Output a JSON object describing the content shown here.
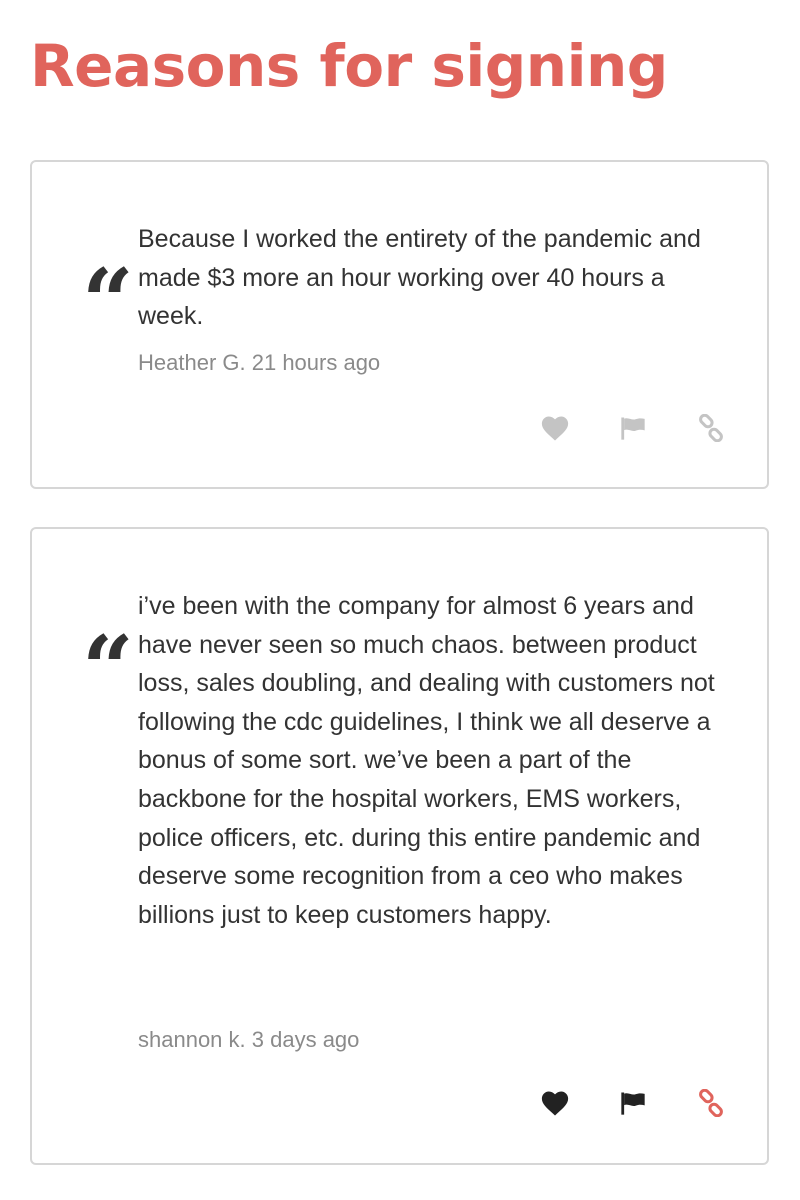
{
  "page": {
    "title": "Reasons for signing"
  },
  "colors": {
    "accent": "#e0645c",
    "text": "#333333",
    "muted": "#8a8a8a",
    "icon_inactive": "#c4c4c4",
    "icon_active": "#222222",
    "border": "#d6d6d6"
  },
  "reasons": [
    {
      "quote_glyph": "“",
      "text": "Because I worked the entirety of the pandemic and made $3 more an hour working over 40 hours a week.",
      "author": "Heather G.",
      "time_ago": "21 hours ago",
      "actions": [
        {
          "icon": "heart-icon",
          "state": "inactive"
        },
        {
          "icon": "flag-icon",
          "state": "inactive"
        },
        {
          "icon": "link-icon",
          "state": "inactive"
        }
      ]
    },
    {
      "quote_glyph": "“",
      "text": "i’ve been with the company for almost 6 years and have never seen so much chaos. between product loss, sales doubling, and dealing with customers not following the cdc guidelines, I think we all deserve a bonus of some sort. we’ve been a part of the backbone for the hospital workers, EMS workers, police officers, etc. during this entire pandemic and deserve some recognition from a ceo who makes billions just to keep customers happy.",
      "author": "shannon k.",
      "time_ago": "3 days ago",
      "actions": [
        {
          "icon": "heart-icon",
          "state": "active"
        },
        {
          "icon": "flag-icon",
          "state": "active"
        },
        {
          "icon": "link-icon",
          "state": "accent"
        }
      ]
    }
  ]
}
